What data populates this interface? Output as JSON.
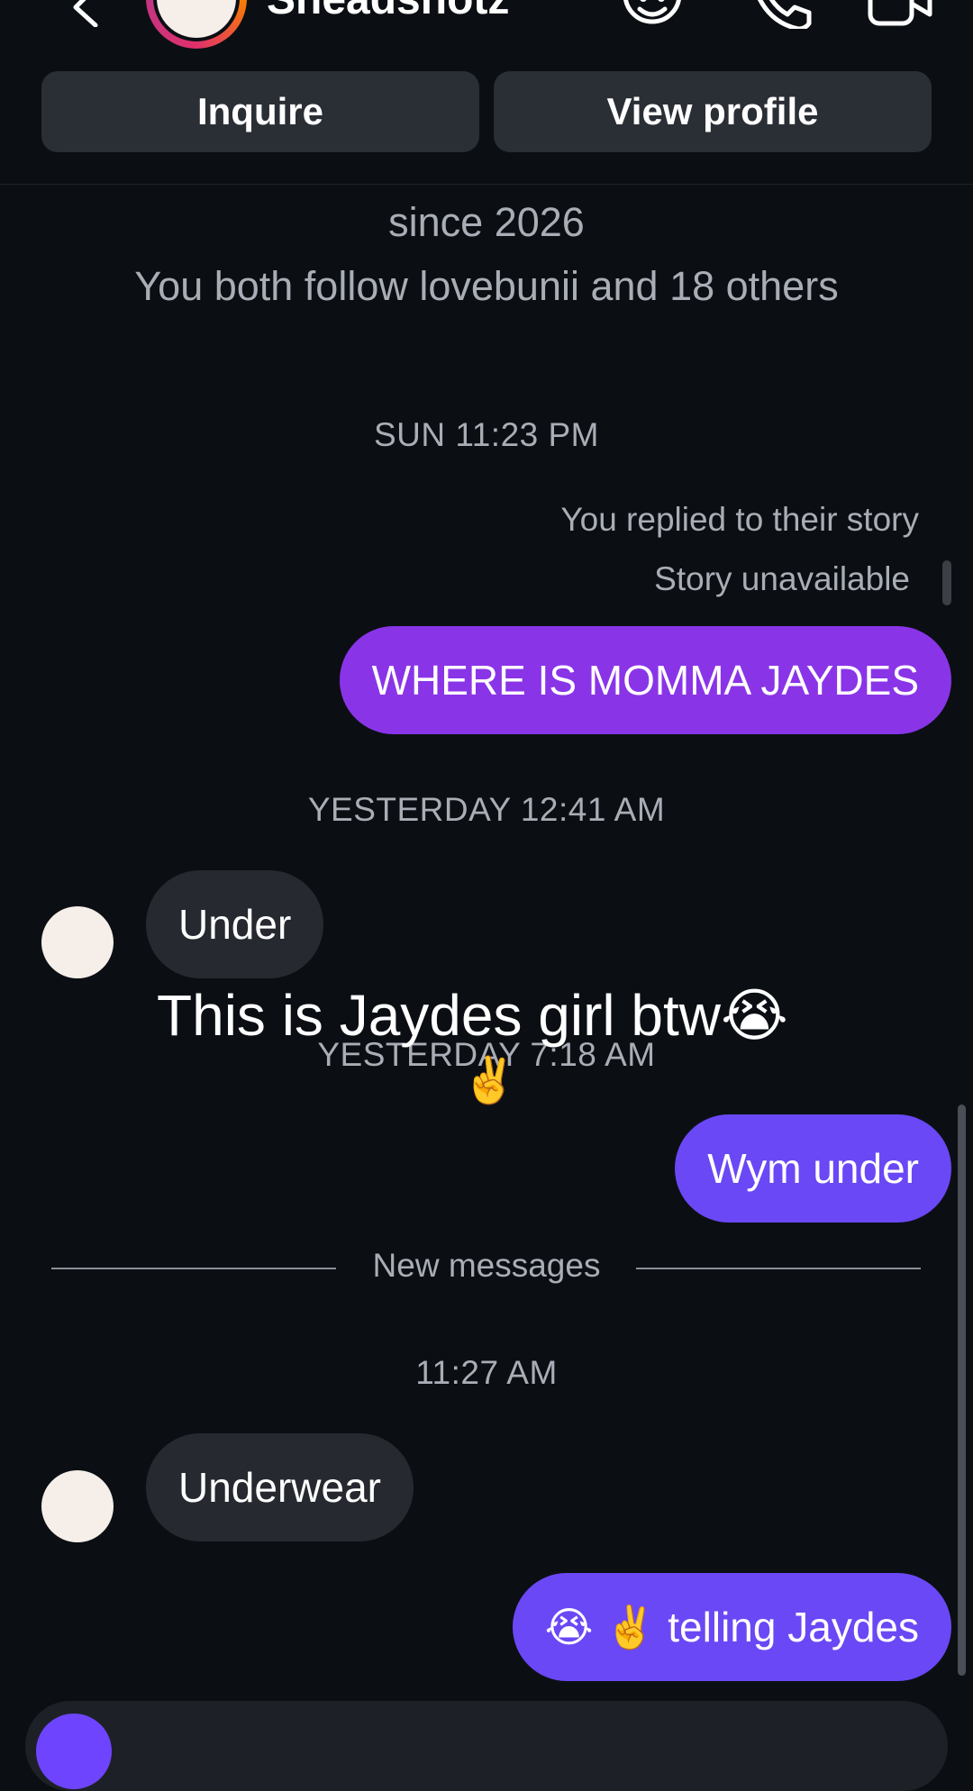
{
  "header": {
    "username": "Sneadshotz",
    "actions": {
      "inquire_label": "Inquire",
      "view_profile_label": "View profile"
    },
    "icons": [
      "back-icon",
      "sticker-icon",
      "phone-icon",
      "video-icon"
    ]
  },
  "profile_info": {
    "since_line": "since 2026",
    "mutual_line": "You both follow lovebunii and 18 others"
  },
  "thread": {
    "timestamp_1": "SUN 11:23 PM",
    "story_reply_note": "You replied to their story",
    "story_unavailable": "Story unavailable",
    "msg_where": "WHERE IS MOMMA JAYDES",
    "timestamp_2": "YESTERDAY 12:41 AM",
    "msg_under": "Under",
    "timestamp_3": "YESTERDAY 7:18 AM",
    "msg_wym": "Wym under",
    "new_messages_label": "New messages",
    "timestamp_4": "11:27 AM",
    "msg_underwear": "Underwear",
    "msg_telling": "😭 ✌️ telling Jaydes"
  },
  "overlay": {
    "caption": "This is Jaydes girl btw😭",
    "emoji": "✌️"
  },
  "colors": {
    "background": "#0b0f14",
    "bubble_out_purple": "#8a34e8",
    "bubble_out_violet": "#6a48f5",
    "bubble_in": "#262a30",
    "button": "#2a2e35"
  }
}
